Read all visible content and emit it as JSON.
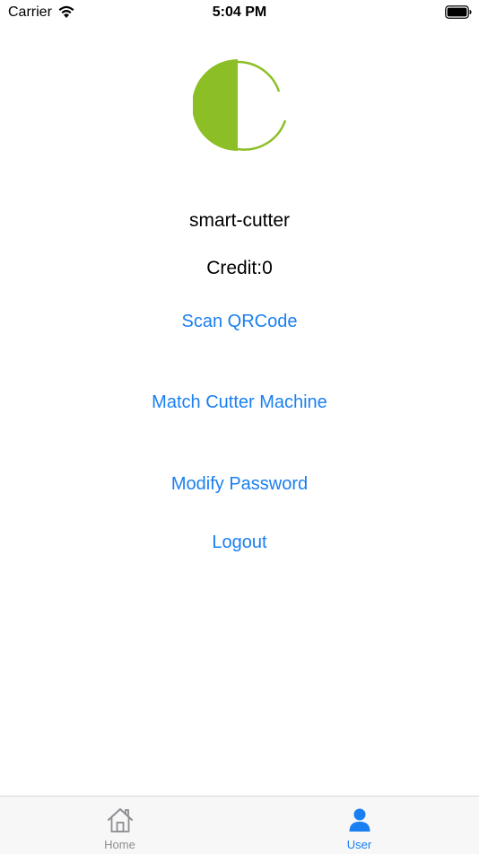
{
  "status_bar": {
    "carrier": "Carrier",
    "time": "5:04 PM",
    "icons": [
      "wifi-icon",
      "battery-icon"
    ]
  },
  "logo": {
    "icon": "logo-icon",
    "color": "#8cbf26"
  },
  "profile": {
    "username": "smart-cutter",
    "credit_label": "Credit:",
    "credit_value": "0"
  },
  "actions": {
    "scan_qrcode": "Scan QRCode",
    "match_cutter": "Match Cutter Machine",
    "modify_password": "Modify Password",
    "logout": "Logout"
  },
  "tab_bar": {
    "tabs": [
      {
        "label": "Home",
        "icon": "home-icon",
        "active": false
      },
      {
        "label": "User",
        "icon": "user-icon",
        "active": true
      }
    ],
    "active_color": "#1a7ff0",
    "inactive_color": "#8e8e93"
  }
}
